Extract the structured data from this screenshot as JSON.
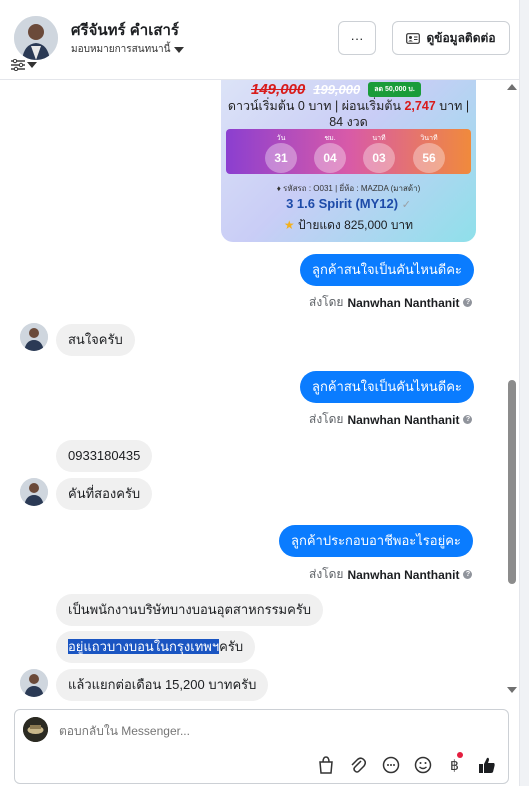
{
  "header": {
    "contact_name": "ศรีจันทร์ คำเสาร์",
    "assign_label": "มอบหมายการสนทนานี้",
    "more_label": "···",
    "contact_info_label": "ดูข้อมูลติดต่อ"
  },
  "promo": {
    "price_new": "149,000",
    "price_old": "199,000",
    "discount": "ลด 50,000 บ.",
    "down_line1_a": "ดาวน์เริ่มต้น 0 บาท | ผ่อนเริ่มต้น ",
    "down_line1_red": "2,747",
    "down_line1_b": " บาท |",
    "down_line2": "84 งวด",
    "timer": [
      {
        "label": "วัน",
        "value": "31"
      },
      {
        "label": "ชม.",
        "value": "04"
      },
      {
        "label": "นาที",
        "value": "03"
      },
      {
        "label": "วินาที",
        "value": "56"
      }
    ],
    "spec": "รหัสรถ : O031 | ยี่ห้อ : MAZDA (มาสด้า)",
    "model": "3 1.6 Spirit (MY12)",
    "red_plate": "ป้ายแดง 825,000 บาท"
  },
  "messages": {
    "out1": "ลูกค้าสนใจเป็นคันไหนดีคะ",
    "sent_prefix": "ส่งโดย",
    "sender": "Nanwhan Nanthanit",
    "in1": "สนใจครับ",
    "out2": "ลูกค้าสนใจเป็นคันไหนดีคะ",
    "in2": "0933180435",
    "in3": "คันที่สองครับ",
    "out3": "ลูกค้าประกอบอาชีพอะไรอยู่คะ",
    "in4": "เป็นพนักงานบริษัทบางบอนอุตสาหกรรมครับ",
    "in5_highlight": "อยู่แถวบางบอนในกรุงเทพฯ",
    "in5_rest": "ครับ",
    "in6": "แล้วแยกต่อเดือน 15,200 บาทครับ"
  },
  "composer": {
    "placeholder": "ตอบกลับใน Messenger..."
  }
}
